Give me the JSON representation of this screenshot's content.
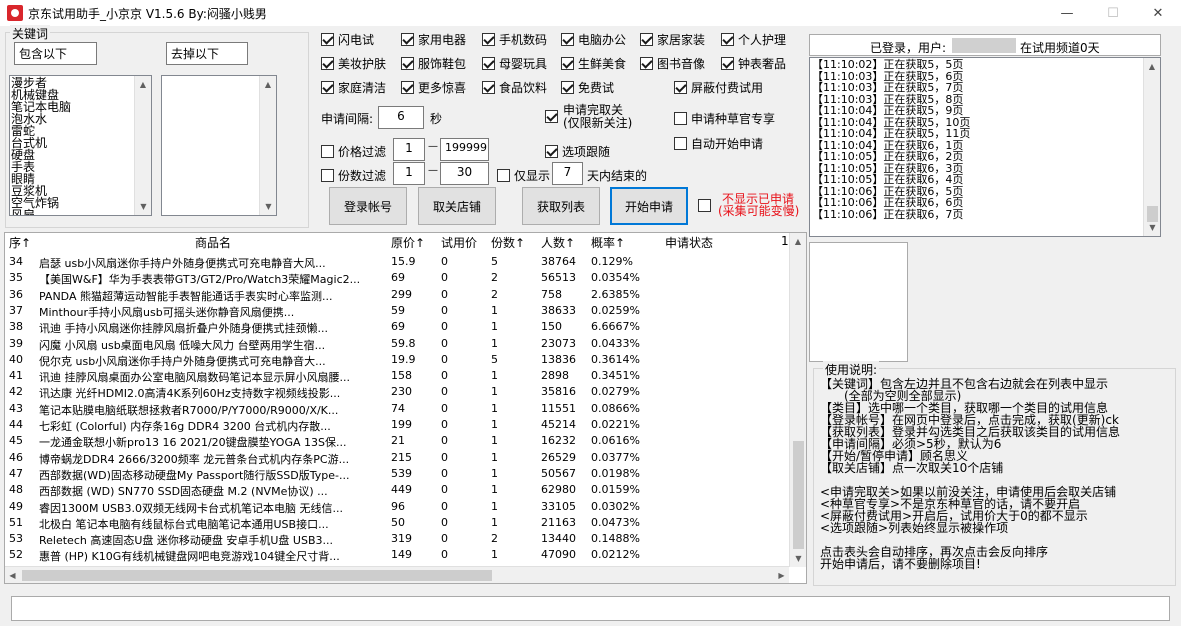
{
  "window": {
    "title": "京东试用助手_小京京  V1.5.6  By:闷骚小贱男",
    "minimize": "—",
    "maximize": "☐",
    "close": "✕"
  },
  "keywords": {
    "group_label": "关键词",
    "include_value": "包含以下",
    "exclude_value": "去掉以下",
    "include_items": [
      "漫步者",
      "机械键盘",
      "笔记本电脑",
      "泡水水",
      "雷蛇",
      "台式机",
      "硬盘",
      "手表",
      "眼睛",
      "豆浆机",
      "空气炸锅",
      "风扇"
    ],
    "exclude_items": []
  },
  "categories": [
    {
      "label": "闪电试",
      "checked": true
    },
    {
      "label": "家用电器",
      "checked": true
    },
    {
      "label": "手机数码",
      "checked": true
    },
    {
      "label": "电脑办公",
      "checked": true
    },
    {
      "label": "家居家装",
      "checked": true
    },
    {
      "label": "个人护理",
      "checked": true
    },
    {
      "label": "美妆护肤",
      "checked": true
    },
    {
      "label": "服饰鞋包",
      "checked": true
    },
    {
      "label": "母婴玩具",
      "checked": true
    },
    {
      "label": "生鲜美食",
      "checked": true
    },
    {
      "label": "图书音像",
      "checked": true
    },
    {
      "label": "钟表奢品",
      "checked": true
    },
    {
      "label": "家庭清洁",
      "checked": true
    },
    {
      "label": "更多惊喜",
      "checked": true
    },
    {
      "label": "食品饮料",
      "checked": true
    },
    {
      "label": "免费试",
      "checked": true
    },
    {
      "label": "屏蔽付费试用",
      "checked": true
    }
  ],
  "settings": {
    "interval_label": "申请间隔:",
    "interval_value": "6",
    "interval_unit": "秒",
    "auto_cancel_label_1": "申请完取关",
    "auto_cancel_label_2": "(仅限新关注)",
    "seed_label": "申请种草官专享",
    "auto_start_label": "自动开始申请",
    "price_filter_label": "价格过滤",
    "price_min": "1",
    "price_max": "199999",
    "dash": "—",
    "follow_label": "选项跟随",
    "count_filter_label": "份数过滤",
    "count_min": "1",
    "count_max": "30",
    "only_show_label": "仅显示",
    "days_value": "7",
    "days_suffix": "天内结束的",
    "hide_applied_1": "不显示已申请",
    "hide_applied_2": "(采集可能变慢)"
  },
  "buttons": {
    "login": "登录帐号",
    "unfollow": "取关店铺",
    "get_list": "获取列表",
    "start": "开始申请"
  },
  "status": {
    "logged_in": "已登录，用户:",
    "channel_label": "在试用频道0天"
  },
  "log_lines": [
    "【11:10:02】正在获取5，5页",
    "【11:10:03】正在获取5，6页",
    "【11:10:03】正在获取5，7页",
    "【11:10:03】正在获取5，8页",
    "【11:10:04】正在获取5，9页",
    "【11:10:04】正在获取5，10页",
    "【11:10:04】正在获取5，11页",
    "【11:10:04】正在获取6，1页",
    "【11:10:05】正在获取6，2页",
    "【11:10:05】正在获取6，3页",
    "【11:10:05】正在获取6，4页",
    "【11:10:06】正在获取6，5页",
    "【11:10:06】正在获取6，6页",
    "【11:10:06】正在获取6，7页"
  ],
  "table": {
    "headers": [
      "序↑",
      "商品名",
      "原价↑",
      "试用价",
      "份数↑",
      "人数↑",
      "概率↑",
      "申请状态",
      "1"
    ],
    "rows": [
      [
        "34",
        "启瑟 usb小风扇迷你手持户外随身便携式可充电静音大风...",
        "15.9",
        "0",
        "5",
        "38764",
        "0.129%"
      ],
      [
        "35",
        "【美国W&F】华为手表表带GT3/GT2/Pro/Watch3荣耀Magic2...",
        "69",
        "0",
        "2",
        "56513",
        "0.0354%"
      ],
      [
        "36",
        "PANDA 熊猫超薄运动智能手表智能通话手表实时心率监测...",
        "299",
        "0",
        "2",
        "758",
        "2.6385%"
      ],
      [
        "37",
        "Minthour手持小风扇usb可摇头迷你静音风扇便携...",
        "59",
        "0",
        "1",
        "38633",
        "0.0259%"
      ],
      [
        "38",
        "讯迪 手持小风扇迷你挂脖风扇折叠户外随身便携式挂颈懒...",
        "69",
        "0",
        "1",
        "150",
        "6.6667%"
      ],
      [
        "39",
        "闪魔 小风扇 usb桌面电风扇 低噪大风力 台壁两用学生宿...",
        "59.8",
        "0",
        "1",
        "23073",
        "0.0433%"
      ],
      [
        "40",
        "倪尔克 usb小风扇迷你手持户外随身便携式可充电静音大...",
        "19.9",
        "0",
        "5",
        "13836",
        "0.3614%"
      ],
      [
        "41",
        "讯迪 挂脖风扇桌面办公室电脑风扇数码笔记本显示屏小风扇腰...",
        "158",
        "0",
        "1",
        "2898",
        "0.3451%"
      ],
      [
        "42",
        "讯达康 光纤HDMI2.0高清4K系列60Hz支持数字视频线投影...",
        "230",
        "0",
        "1",
        "35816",
        "0.0279%"
      ],
      [
        "43",
        "笔记本贴膜电脑纸联想拯救者R7000/P/Y7000/R9000/X/K...",
        "74",
        "0",
        "1",
        "11551",
        "0.0866%"
      ],
      [
        "44",
        "七彩虹 (Colorful) 内存条16g DDR4 3200 台式机内存散...",
        "199",
        "0",
        "1",
        "45214",
        "0.0221%"
      ],
      [
        "45",
        "一龙通金联想小新pro13 16 2021/20键盘膜垫YOGA 13S保...",
        "21",
        "0",
        "1",
        "16232",
        "0.0616%"
      ],
      [
        "46",
        "博帝蜗龙DDR4 2666/3200频率 龙元普条台式机内存条PC游...",
        "215",
        "0",
        "1",
        "26529",
        "0.0377%"
      ],
      [
        "47",
        "西部数据(WD)固态移动硬盘My Passport随行版SSD版Type-...",
        "539",
        "0",
        "1",
        "50567",
        "0.0198%"
      ],
      [
        "48",
        "西部数据 (WD) SN770 SSD固态硬盘 M.2 (NVMe协议) ...",
        "449",
        "0",
        "1",
        "62980",
        "0.0159%"
      ],
      [
        "49",
        "睿因1300M USB3.0双频无线网卡台式机笔记本电脑 无线信...",
        "96",
        "0",
        "1",
        "33105",
        "0.0302%"
      ],
      [
        "51",
        "北极白 笔记本电脑有线鼠标台式电脑笔记本通用USB接口...",
        "50",
        "0",
        "1",
        "21163",
        "0.0473%"
      ],
      [
        "53",
        "Reletech 高速固态U盘 迷你移动硬盘 安卓手机U盘 USB3...",
        "319",
        "0",
        "2",
        "13440",
        "0.1488%"
      ],
      [
        "52",
        "惠普 (HP) K10G有线机械键盘网吧电竞游戏104键全尺寸背...",
        "149",
        "0",
        "1",
        "47090",
        "0.0212%"
      ]
    ]
  },
  "usage": {
    "title": "使用说明:",
    "lines": [
      "【关键词】包含左边并且不包含右边就会在列表中显示",
      "　　(全部为空则全部显示)",
      "【类目】选中哪一个类目，获取哪一个类目的试用信息",
      "【登录帐号】在网页中登录后，点击完成，获取(更新)ck",
      "【获取列表】登录并勾选类目之后获取该类目的试用信息",
      "【申请间隔】必须>5秒，默认为6",
      "【开始/暂停申请】顾名思义",
      "【取关店铺】点一次取关10个店铺",
      "",
      "<申请完取关>如果以前没关注，申请使用后会取关店铺",
      "<种草官专享>不是京东种草官的话，请不要开启",
      "<屏蔽付费试用>开启后，试用价大于0的都不显示",
      "<选项跟随>列表始终显示被操作项",
      "",
      "点击表头会自动排序，再次点击会反向排序",
      "开始申请后，请不要删除项目!"
    ]
  },
  "colors": {
    "accent": "#0078d7",
    "warning": "#e8121a"
  }
}
